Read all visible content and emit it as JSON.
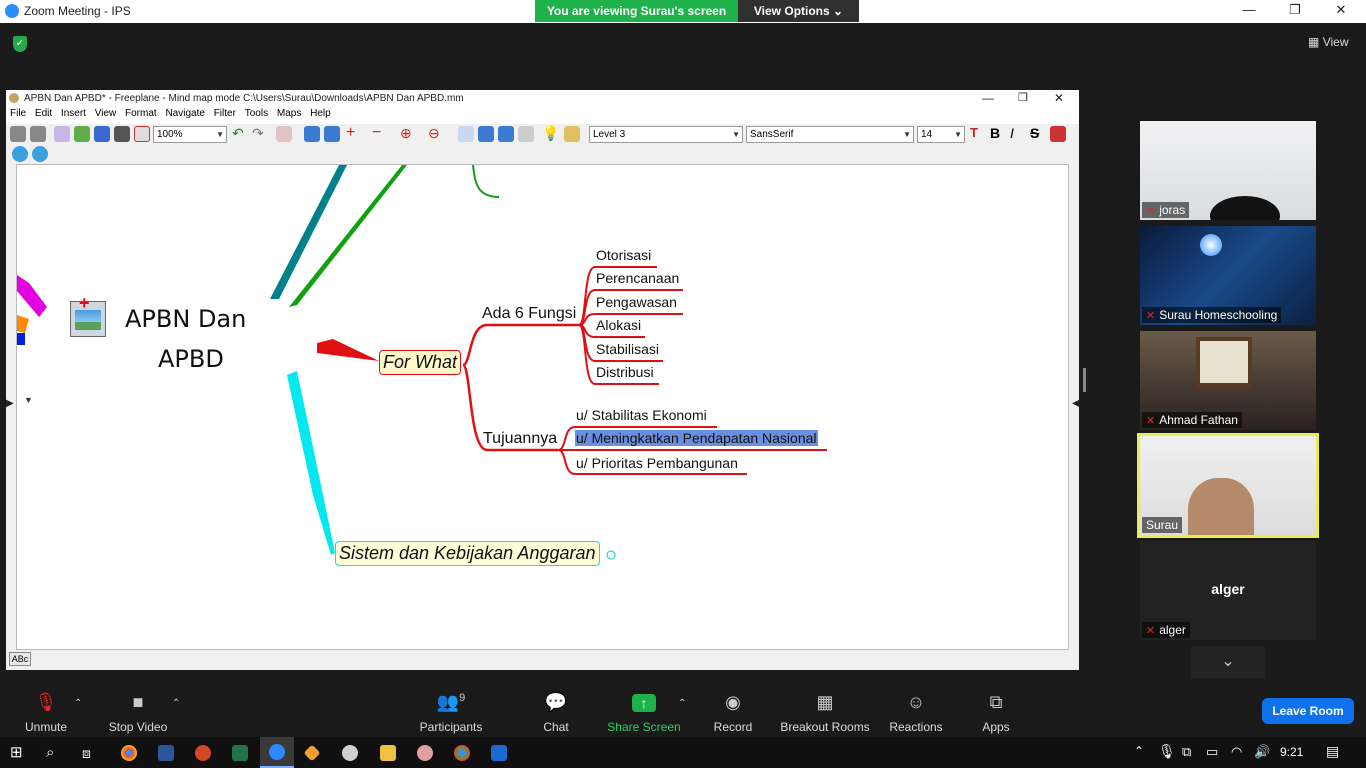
{
  "zoom": {
    "window_title": "Zoom Meeting - IPS",
    "share_banner": "You are viewing Surau's screen",
    "view_options": "View Options",
    "view_label": "View",
    "leave_label": "Leave Room",
    "participants_count": "9",
    "toolbar": [
      {
        "label": "Unmute",
        "icon": "microphone-muted-icon"
      },
      {
        "label": "Stop Video",
        "icon": "video-camera-icon"
      },
      {
        "label": "Participants",
        "icon": "participants-icon"
      },
      {
        "label": "Chat",
        "icon": "chat-icon"
      },
      {
        "label": "Share Screen",
        "icon": "share-screen-icon"
      },
      {
        "label": "Record",
        "icon": "record-icon"
      },
      {
        "label": "Breakout Rooms",
        "icon": "breakout-rooms-icon"
      },
      {
        "label": "Reactions",
        "icon": "reactions-icon"
      },
      {
        "label": "Apps",
        "icon": "apps-icon"
      }
    ],
    "participants": [
      {
        "name": "joras"
      },
      {
        "name": "Surau Homeschooling"
      },
      {
        "name": "Ahmad Fathan"
      },
      {
        "name": "Surau"
      },
      {
        "name": "alger"
      }
    ],
    "colors": {
      "banner_green": "#20b24a",
      "leave_blue": "#0e72ed",
      "active_border": "#e8ef4a"
    }
  },
  "freeplane": {
    "title": "APBN Dan APBD* - Freeplane - Mind map mode C:\\Users\\Surau\\Downloads\\APBN Dan APBD.mm",
    "menu": [
      "File",
      "Edit",
      "Insert",
      "View",
      "Format",
      "Navigate",
      "Filter",
      "Tools",
      "Maps",
      "Help"
    ],
    "zoom_value": "100%",
    "level_value": "Level 3",
    "font_value": "SansSerif",
    "size_value": "14",
    "status_text": "ABc"
  },
  "mindmap": {
    "root_line1": "APBN Dan",
    "root_line2": "APBD",
    "for_what": "For What",
    "ada_fungsi": "Ada 6 Fungsi",
    "fungsi": [
      "Otorisasi",
      "Perencanaan",
      "Pengawasan",
      "Alokasi",
      "Stabilisasi",
      "Distribusi"
    ],
    "tujuannya": "Tujuannya",
    "tujuan": [
      "u/ Stabilitas Ekonomi",
      "u/ Meningkatkan Pendapatan Nasional",
      "u/ Prioritas Pembangunan"
    ],
    "sistem": "Sistem dan Kebijakan Anggaran",
    "colors": {
      "branch_red": "#e01010",
      "branch_cyan": "#00e8f0",
      "branch_teal": "#00808a",
      "branch_green": "#10a010",
      "highlight": "#6b8fe0"
    }
  },
  "taskbar": {
    "time": "9:21"
  }
}
